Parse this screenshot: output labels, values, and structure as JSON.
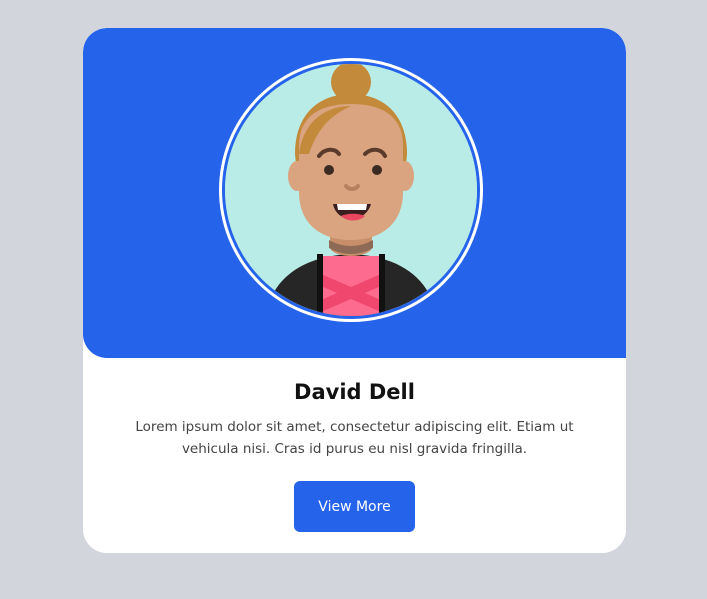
{
  "profile": {
    "name": "David Dell",
    "bio": "Lorem ipsum dolor sit amet, consectetur adipiscing elit. Etiam ut vehicula nisi. Cras id purus eu nisl gravida fringilla.",
    "button_label": "View More"
  },
  "colors": {
    "accent": "#2563eb",
    "background": "#d2d5dc",
    "card": "#ffffff",
    "avatar_bg": "#b9ece6"
  }
}
